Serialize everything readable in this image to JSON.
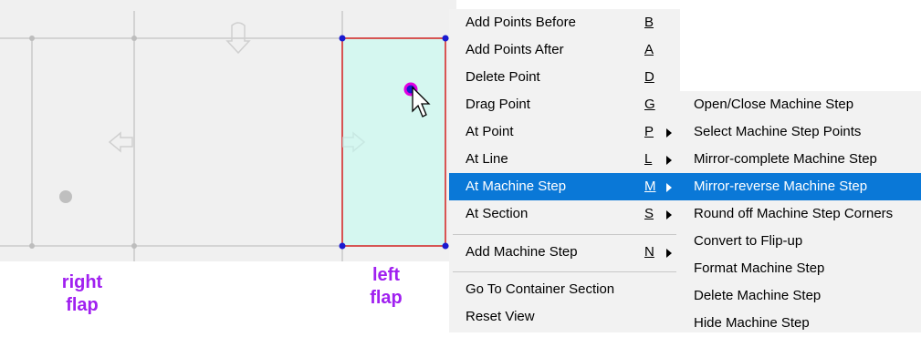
{
  "labels": {
    "right_flap": "right\nflap",
    "left_flap": "left\nflap"
  },
  "main_menu": {
    "items": [
      {
        "label": "Add Points Before",
        "key": "B",
        "submenu": false
      },
      {
        "label": "Add Points After",
        "key": "A",
        "submenu": false
      },
      {
        "label": "Delete Point",
        "key": "D",
        "submenu": false
      },
      {
        "label": "Drag Point",
        "key": "G",
        "submenu": false
      },
      {
        "label": "At Point",
        "key": "P",
        "submenu": true
      },
      {
        "label": "At Line",
        "key": "L",
        "submenu": true
      },
      {
        "label": "At Machine Step",
        "key": "M",
        "submenu": true,
        "selected": true
      },
      {
        "label": "At Section",
        "key": "S",
        "submenu": true
      },
      {
        "label": "Add Machine Step",
        "key": "N",
        "submenu": true
      },
      {
        "label": "Go To Container Section",
        "key": "",
        "submenu": false
      },
      {
        "label": "Reset View",
        "key": "",
        "submenu": false
      }
    ]
  },
  "sub_menu": {
    "items": [
      {
        "label": "Open/Close Machine Step"
      },
      {
        "label": "Select Machine Step Points"
      },
      {
        "label": "Mirror-complete Machine Step"
      },
      {
        "label": "Mirror-reverse Machine Step",
        "selected": true
      },
      {
        "label": "Round off Machine Step Corners"
      },
      {
        "label": "Convert to Flip-up"
      },
      {
        "label": "Format Machine Step"
      },
      {
        "label": "Delete Machine Step"
      },
      {
        "label": "Hide Machine Step"
      }
    ]
  },
  "colors": {
    "flap_label": "#a020f0",
    "selected_fill": "#0a78d7",
    "machine_step_fill": "#d5f7f0",
    "machine_step_outline": "#d42020",
    "point_marker": "#1a1ad0"
  }
}
